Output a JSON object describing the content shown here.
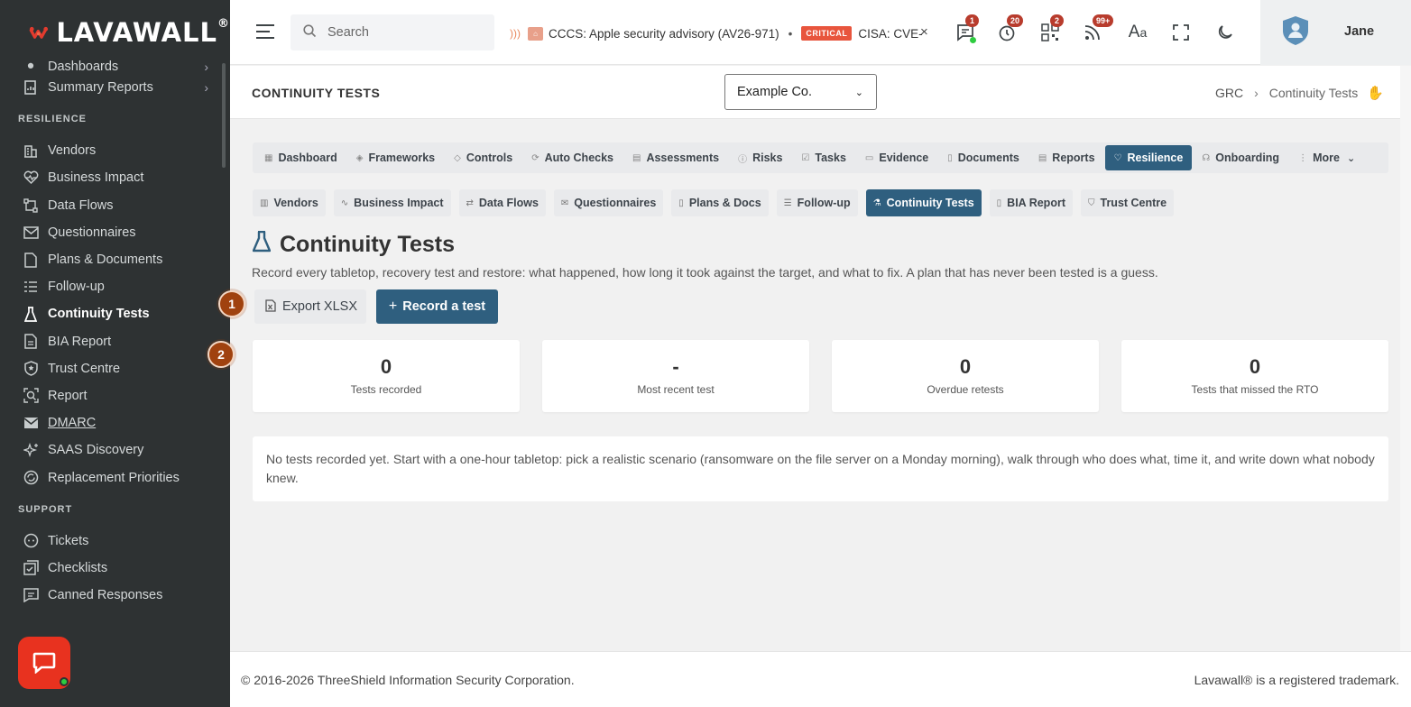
{
  "brand": {
    "name": "LAVAWALL",
    "reg": "®"
  },
  "sidebar": {
    "partial_item": "Dashboards",
    "items_top": [
      {
        "label": "Summary Reports",
        "icon": "report-icon",
        "chevron": "›"
      }
    ],
    "section_resilience": "RESILIENCE",
    "items_resilience": [
      {
        "label": "Vendors"
      },
      {
        "label": "Business Impact"
      },
      {
        "label": "Data Flows"
      },
      {
        "label": "Questionnaires"
      },
      {
        "label": "Plans & Documents"
      },
      {
        "label": "Follow-up"
      },
      {
        "label": "Continuity Tests"
      },
      {
        "label": "BIA Report"
      },
      {
        "label": "Trust Centre"
      },
      {
        "label": "Report"
      },
      {
        "label": "DMARC"
      },
      {
        "label": "SAAS Discovery"
      },
      {
        "label": "Replacement Priorities"
      }
    ],
    "section_support": "SUPPORT",
    "items_support": [
      {
        "label": "Tickets"
      },
      {
        "label": "Checklists"
      },
      {
        "label": "Canned Responses"
      }
    ]
  },
  "topbar": {
    "search_placeholder": "Search",
    "ticker_item1": "CCCS: Apple security advisory (AV26-971)",
    "ticker_sep": "•",
    "ticker_critical": "CRITICAL",
    "ticker_item2": "CISA: CVE-",
    "ticker_close": "×",
    "badges": {
      "messages": "1",
      "timer": "20",
      "qr": "2",
      "feeds": "99+"
    },
    "user_name": "Jane"
  },
  "page_header": {
    "title": "CONTINUITY TESTS",
    "org": "Example Co.",
    "breadcrumb_root": "GRC",
    "breadcrumb_sep": "›",
    "breadcrumb_current": "Continuity Tests"
  },
  "main_tabs": [
    {
      "label": "Dashboard",
      "icon": "▦"
    },
    {
      "label": "Frameworks",
      "icon": "◈"
    },
    {
      "label": "Controls",
      "icon": "◇"
    },
    {
      "label": "Auto Checks",
      "icon": "⟳"
    },
    {
      "label": "Assessments",
      "icon": "▤"
    },
    {
      "label": "Risks",
      "icon": "ⓘ"
    },
    {
      "label": "Tasks",
      "icon": "☑"
    },
    {
      "label": "Evidence",
      "icon": "▭"
    },
    {
      "label": "Documents",
      "icon": "▯"
    },
    {
      "label": "Reports",
      "icon": "▤"
    },
    {
      "label": "Resilience",
      "icon": "♡"
    },
    {
      "label": "Onboarding",
      "icon": "☊"
    },
    {
      "label": "More",
      "icon": "⋮"
    }
  ],
  "sub_tabs": [
    {
      "label": "Vendors",
      "icon": "▥"
    },
    {
      "label": "Business Impact",
      "icon": "∿"
    },
    {
      "label": "Data Flows",
      "icon": "⇄"
    },
    {
      "label": "Questionnaires",
      "icon": "✉"
    },
    {
      "label": "Plans & Docs",
      "icon": "▯"
    },
    {
      "label": "Follow-up",
      "icon": "☰"
    },
    {
      "label": "Continuity Tests",
      "icon": "⚗"
    },
    {
      "label": "BIA Report",
      "icon": "▯"
    },
    {
      "label": "Trust Centre",
      "icon": "⛉"
    }
  ],
  "main": {
    "title": "Continuity Tests",
    "description": "Record every tabletop, recovery test and restore: what happened, how long it took against the target, and what to fix. A plan that has never been tested is a guess.",
    "export_label": "Export XLSX",
    "record_label": "Record a test",
    "markers": [
      "1",
      "2"
    ],
    "stats": [
      {
        "value": "0",
        "label": "Tests recorded"
      },
      {
        "value": "-",
        "label": "Most recent test"
      },
      {
        "value": "0",
        "label": "Overdue retests"
      },
      {
        "value": "0",
        "label": "Tests that missed the RTO"
      }
    ],
    "empty_text": "No tests recorded yet. Start with a one-hour tabletop: pick a realistic scenario (ransomware on the file server on a Monday morning), walk through who does what, time it, and write down what nobody knew."
  },
  "footer": {
    "copyright": "© 2016-2026 ThreeShield Information Security Corporation.",
    "trademark": "Lavawall® is a registered trademark."
  },
  "colors": {
    "accent": "#2f5f7f",
    "sidebar_bg": "#2e3233",
    "marker": "#a0420f",
    "chat": "#e8321f"
  }
}
